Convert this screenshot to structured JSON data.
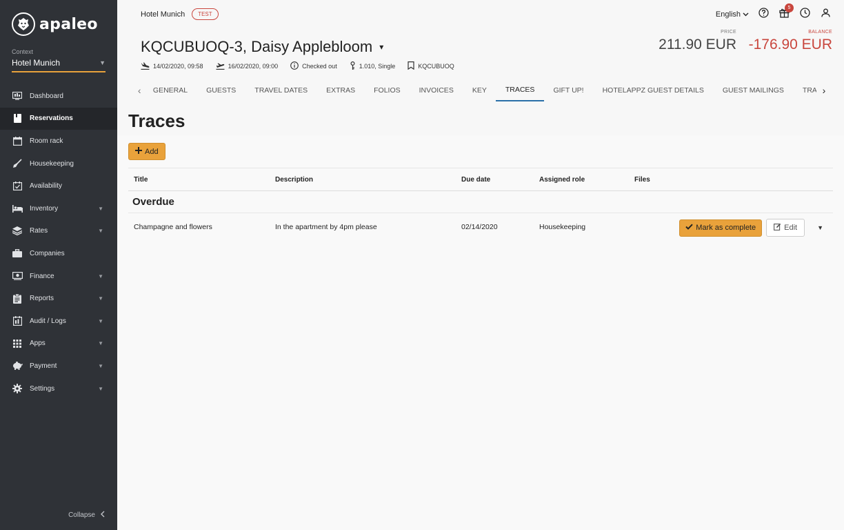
{
  "app": {
    "logo_text": "apaleo",
    "context_label": "Context",
    "context_value": "Hotel Munich",
    "collapse_label": "Collapse"
  },
  "sidebar": {
    "items": [
      {
        "label": "Dashboard",
        "icon": "dashboard-icon",
        "active": false,
        "caret": false
      },
      {
        "label": "Reservations",
        "icon": "reservations-icon",
        "active": true,
        "caret": false
      },
      {
        "label": "Room rack",
        "icon": "calendar-icon",
        "active": false,
        "caret": false
      },
      {
        "label": "Housekeeping",
        "icon": "broom-icon",
        "active": false,
        "caret": false
      },
      {
        "label": "Availability",
        "icon": "calendar-check-icon",
        "active": false,
        "caret": false
      },
      {
        "label": "Inventory",
        "icon": "bed-icon",
        "active": false,
        "caret": true
      },
      {
        "label": "Rates",
        "icon": "layers-icon",
        "active": false,
        "caret": true
      },
      {
        "label": "Companies",
        "icon": "briefcase-icon",
        "active": false,
        "caret": false
      },
      {
        "label": "Finance",
        "icon": "money-icon",
        "active": false,
        "caret": true
      },
      {
        "label": "Reports",
        "icon": "clipboard-icon",
        "active": false,
        "caret": true
      },
      {
        "label": "Audit / Logs",
        "icon": "audit-icon",
        "active": false,
        "caret": true
      },
      {
        "label": "Apps",
        "icon": "grid-icon",
        "active": false,
        "caret": true
      },
      {
        "label": "Payment",
        "icon": "piggy-bank-icon",
        "active": false,
        "caret": true
      },
      {
        "label": "Settings",
        "icon": "gear-icon",
        "active": false,
        "caret": true
      }
    ]
  },
  "header": {
    "hotel": "Hotel Munich",
    "test_badge": "TEST",
    "language": "English",
    "gift_badge": "5",
    "reservation_title": "KQCUBUOQ-3, Daisy Applebloom",
    "price_label": "PRICE",
    "price_value": "211.90 EUR",
    "balance_label": "BALANCE",
    "balance_value": "-176.90 EUR",
    "arrival": "14/02/2020, 09:58",
    "departure": "16/02/2020, 09:00",
    "status": "Checked out",
    "unit": "1.010, Single",
    "booking_id": "KQCUBUOQ"
  },
  "tabs": [
    {
      "label": "GENERAL",
      "active": false
    },
    {
      "label": "GUESTS",
      "active": false
    },
    {
      "label": "TRAVEL DATES",
      "active": false
    },
    {
      "label": "EXTRAS",
      "active": false
    },
    {
      "label": "FOLIOS",
      "active": false
    },
    {
      "label": "INVOICES",
      "active": false
    },
    {
      "label": "KEY",
      "active": false
    },
    {
      "label": "TRACES",
      "active": true
    },
    {
      "label": "GIFT UP!",
      "active": false
    },
    {
      "label": "HOTELAPPZ GUEST DETAILS",
      "active": false
    },
    {
      "label": "GUEST MAILINGS",
      "active": false
    },
    {
      "label": "TRAC",
      "active": false
    }
  ],
  "page": {
    "title": "Traces",
    "add_label": "Add"
  },
  "table": {
    "headers": {
      "title": "Title",
      "description": "Description",
      "due_date": "Due date",
      "assigned_role": "Assigned role",
      "files": "Files"
    },
    "group_label": "Overdue",
    "rows": [
      {
        "title": "Champagne and flowers",
        "description": "In the apartment by 4pm please",
        "due_date": "02/14/2020",
        "assigned_role": "Housekeeping",
        "files": "",
        "complete_label": "Mark as complete",
        "edit_label": "Edit"
      }
    ]
  },
  "colors": {
    "sidebar_bg": "#2f3237",
    "accent": "#e9a23b",
    "danger": "#c9463d",
    "tab_active": "#2a6fa8"
  }
}
